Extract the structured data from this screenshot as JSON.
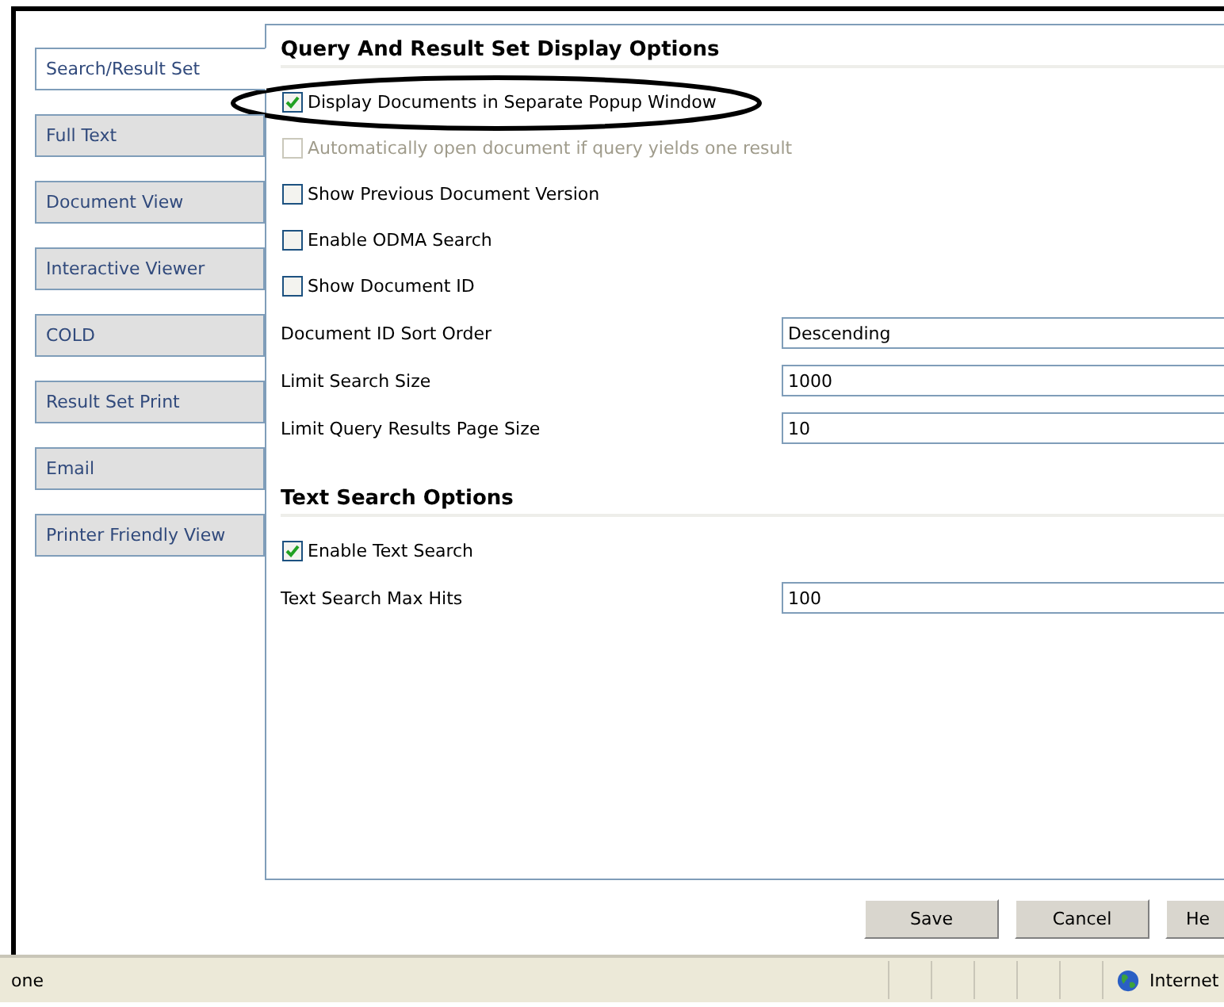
{
  "tabs": [
    {
      "label": "Search/Result Set",
      "selected": true
    },
    {
      "label": "Full Text",
      "selected": false
    },
    {
      "label": "Document View",
      "selected": false
    },
    {
      "label": "Interactive Viewer",
      "selected": false
    },
    {
      "label": "COLD",
      "selected": false
    },
    {
      "label": "Result Set Print",
      "selected": false
    },
    {
      "label": "Email",
      "selected": false
    },
    {
      "label": "Printer Friendly View",
      "selected": false
    }
  ],
  "sections": [
    {
      "title": "Query And Result Set Display Options",
      "items": [
        {
          "kind": "checkbox",
          "label": "Display Documents in Separate Popup Window",
          "checked": true,
          "disabled": false
        },
        {
          "kind": "checkbox",
          "label": "Automatically open document if query yields one result",
          "checked": false,
          "disabled": true
        },
        {
          "kind": "checkbox",
          "label": "Show Previous Document Version",
          "checked": false,
          "disabled": false
        },
        {
          "kind": "checkbox",
          "label": "Enable ODMA Search",
          "checked": false,
          "disabled": false
        },
        {
          "kind": "checkbox",
          "label": "Show Document ID",
          "checked": false,
          "disabled": false
        },
        {
          "kind": "field",
          "label": "Document ID Sort Order",
          "value": "Descending"
        },
        {
          "kind": "field",
          "label": "Limit Search Size",
          "value": "1000"
        },
        {
          "kind": "field",
          "label": "Limit Query Results Page Size",
          "value": "10"
        }
      ]
    },
    {
      "title": "Text Search Options",
      "items": [
        {
          "kind": "checkbox",
          "label": "Enable Text Search",
          "checked": true,
          "disabled": false
        },
        {
          "kind": "field",
          "label": "Text Search Max Hits",
          "value": "100"
        }
      ]
    }
  ],
  "buttons": [
    "Save",
    "Cancel",
    "He"
  ],
  "status_bar": {
    "text": "one",
    "zone": "Internet"
  }
}
